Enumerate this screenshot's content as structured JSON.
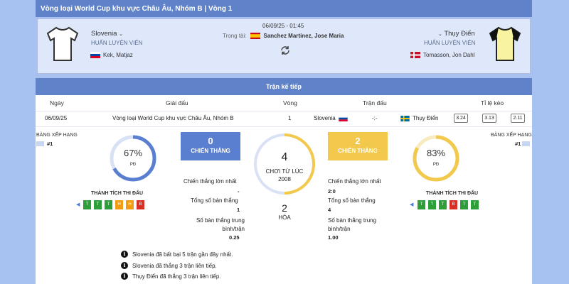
{
  "header": {
    "title": "Vòng loại World Cup khu vực Châu Âu, Nhóm B | Vòng 1"
  },
  "match": {
    "datetime": "06/09/25 - 01:45",
    "referee_label": "Trọng tài:",
    "referee_name": "Sanchez Martinez, Jose Maria",
    "home": {
      "name": "Slovenia",
      "coach_label": "HUẤN LUYỆN VIÊN",
      "coach": "Kek, Matjaz",
      "shirt_color": "#ffffff"
    },
    "away": {
      "name": "Thụy Điển",
      "coach_label": "HUẤN LUYỆN VIÊN",
      "coach": "Tomasson, Jon Dahl",
      "shirt_color": "#f7f3a1"
    }
  },
  "next_match": {
    "section_title": "Trận kế tiếp",
    "headers": {
      "date": "Ngày",
      "league": "Giải đấu",
      "round": "Vòng",
      "match": "Trận đấu",
      "odds": "Tỉ lệ kèo"
    },
    "row": {
      "date": "06/09/25",
      "league": "Vòng loại World Cup khu vực Châu Âu, Nhóm B",
      "round": "1",
      "home": "Slovenia",
      "score": "-:-",
      "away": "Thụy Điển",
      "odds": [
        "3.24",
        "3.13",
        "2.11"
      ]
    }
  },
  "standings": {
    "home": {
      "label": "BẢNG XẾP HẠNG",
      "rank": "#1"
    },
    "away": {
      "label": "BẢNG XẾP HẠNG",
      "rank": "#1"
    }
  },
  "home_stats": {
    "pd_percent": 67,
    "pd_text": "67%",
    "pd_label": "PĐ",
    "form_title": "THÀNH TÍCH THI ĐẤU",
    "form": [
      "T",
      "T",
      "T",
      "H",
      "H",
      "B"
    ],
    "wins": "0",
    "wins_label": "CHIẾN THẮNG",
    "wins_color": "#5b7fd0",
    "biggest_win_label": "Chiến thắng lớn nhất",
    "biggest_win": "-",
    "goals_label": "Tổng số bàn thắng",
    "goals": "1",
    "avg_label": "Số bàn thắng trung bình/trận",
    "avg": "0.25"
  },
  "away_stats": {
    "pd_percent": 83,
    "pd_text": "83%",
    "pd_label": "PĐ",
    "form_title": "THÀNH TÍCH THI ĐẤU",
    "form": [
      "T",
      "T",
      "T",
      "B",
      "T",
      "T"
    ],
    "wins": "2",
    "wins_label": "CHIẾN THẮNG",
    "wins_color": "#f2c94c",
    "biggest_win_label": "Chiến thắng lớn nhất",
    "biggest_win": "2:0",
    "goals_label": "Tổng số bàn thắng",
    "goals": "4",
    "avg_label": "Số bàn thắng trung bình/trận",
    "avg": "1.00"
  },
  "h2h": {
    "total": "4",
    "since_label": "CHƠI TỪ LÚC",
    "since_year": "2008",
    "draws": "2",
    "draws_label": "HÒA"
  },
  "notes": [
    "Slovenia đã bất bại 5 trận gần đây nhất.",
    "Slovenia đã thắng 3 trận liên tiếp.",
    "Thụy Điển đã thắng 3 trận liên tiếp."
  ],
  "colors": {
    "win": "#2e9e3a",
    "draw": "#f39c12",
    "loss": "#d93025",
    "home_accent": "#5b7fd0",
    "away_accent": "#f2c94c"
  },
  "icons": {
    "refresh": "refresh-icon",
    "info": "info-icon",
    "chevron": "chevron-down-icon"
  }
}
